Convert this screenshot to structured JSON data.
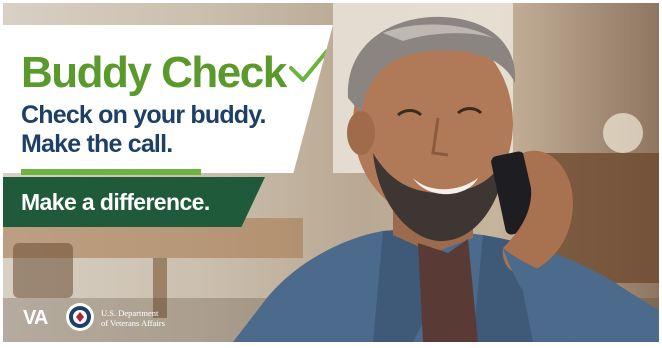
{
  "banner": {
    "title": "Buddy Check",
    "subtitle_line1": "Check on your buddy.",
    "subtitle_line2": "Make the call.",
    "cta": "Make a difference.",
    "org_short": "VA",
    "org_line1": "U.S. Department",
    "org_line2": "of Veterans Affairs"
  },
  "colors": {
    "title_green": "#5a9a2c",
    "subtitle_navy": "#1e3f66",
    "accent_green": "#6db33f",
    "cta_dark_green": "#1f5a3a"
  },
  "icons": [
    "checkmark-icon",
    "va-seal-icon"
  ]
}
